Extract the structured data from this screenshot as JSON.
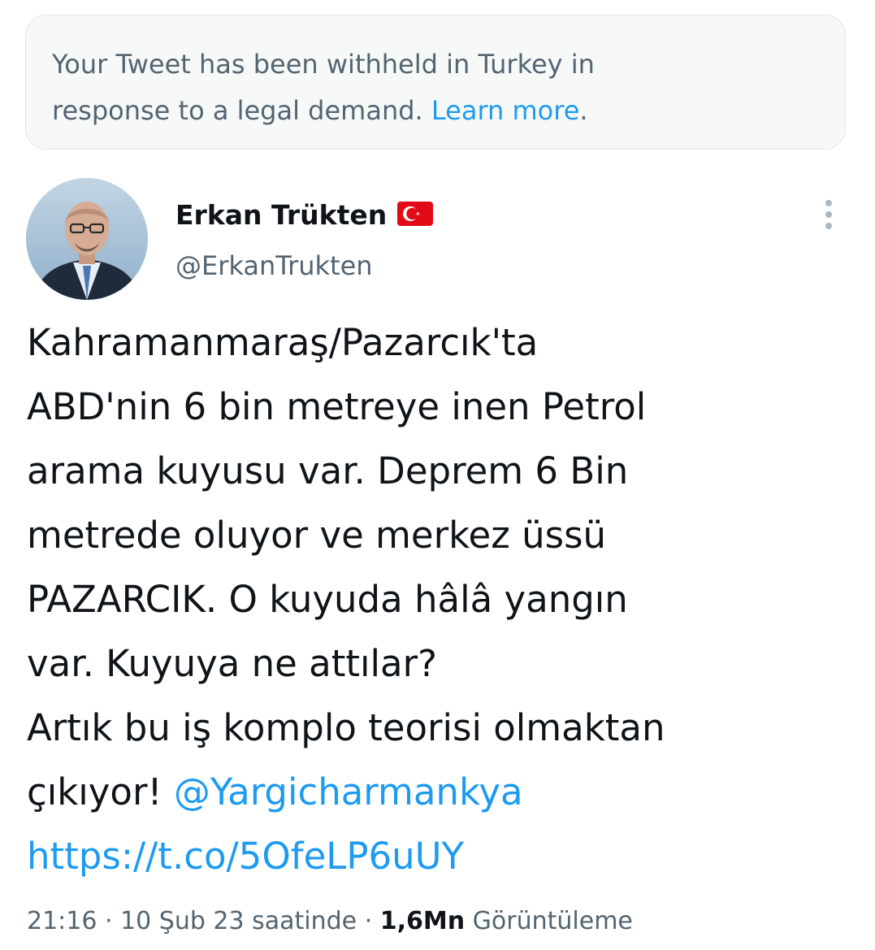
{
  "notice": {
    "line1": "Your Tweet has been withheld in Turkey in",
    "line2_prefix": "response to a legal demand. ",
    "link": "Learn more",
    "suffix": "."
  },
  "author": {
    "display_name": "Erkan Trükten",
    "flag_icon": "turkey-flag-emoji",
    "handle": "@ErkanTrukten",
    "avatar_icon": "profile-photo"
  },
  "more_icon": "vertical-ellipsis-icon",
  "tweet": {
    "lines": [
      "Kahramanmaraş/Pazarcık'ta",
      "ABD'nin 6 bin metreye inen Petrol",
      "arama kuyusu var. Deprem 6 Bin",
      "metrede oluyor ve merkez üssü",
      "PAZARCIK. O kuyuda hâlâ yangın",
      "var. Kuyuya ne attılar?",
      "Artık bu iş komplo teorisi olmaktan"
    ],
    "last_line_prefix": "çıkıyor! ",
    "mention": "@Yargicharmankya",
    "link": "https://t.co/5OfeLP6uUY"
  },
  "meta": {
    "time": "21:16",
    "separator1": " · ",
    "date": "10 Şub 23 saatinde",
    "separator2": " · ",
    "views_count": "1,6Mn",
    "views_label": " Görüntüleme"
  },
  "colors": {
    "link": "#1d9bf0",
    "secondary_text": "#536471",
    "primary_text": "#0f1419",
    "notice_bg": "#f7f9f9"
  }
}
